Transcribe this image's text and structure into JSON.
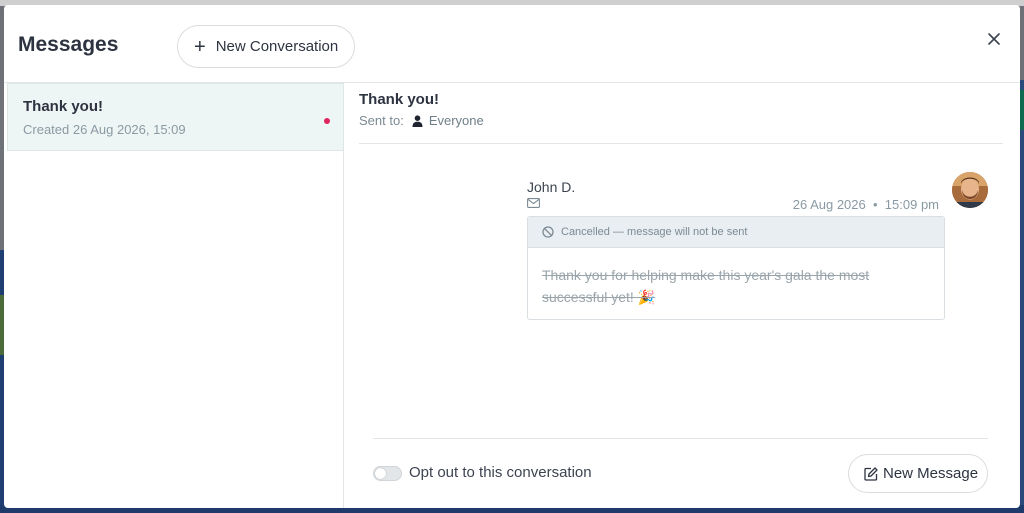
{
  "header": {
    "title": "Messages",
    "new_conversation_label": "New Conversation"
  },
  "sidebar": {
    "conversations": [
      {
        "title": "Thank you!",
        "created": "Created 26 Aug 2026, 15:09",
        "unread": true
      }
    ]
  },
  "thread": {
    "title": "Thank you!",
    "sent_to_label": "Sent to:",
    "recipient": "Everyone",
    "message": {
      "sender": "John D.",
      "date": "26 Aug 2026",
      "time": "15:09 pm",
      "status": "Cancelled — message will not be sent",
      "body": "Thank you for helping make this year's gala the most successful yet! 🎉"
    }
  },
  "footer": {
    "opt_out_label": "Opt out to this conversation",
    "opt_out_enabled": false,
    "new_message_label": "New Message"
  },
  "icons": {
    "plus": "plus-icon",
    "close": "close-icon",
    "person": "person-icon",
    "mail": "mail-icon",
    "ban": "ban-icon",
    "edit": "edit-icon"
  },
  "colors": {
    "unread_dot": "#e0245e",
    "selected_item_bg": "#eef5f5",
    "status_bar_bg": "#e9eef2"
  }
}
